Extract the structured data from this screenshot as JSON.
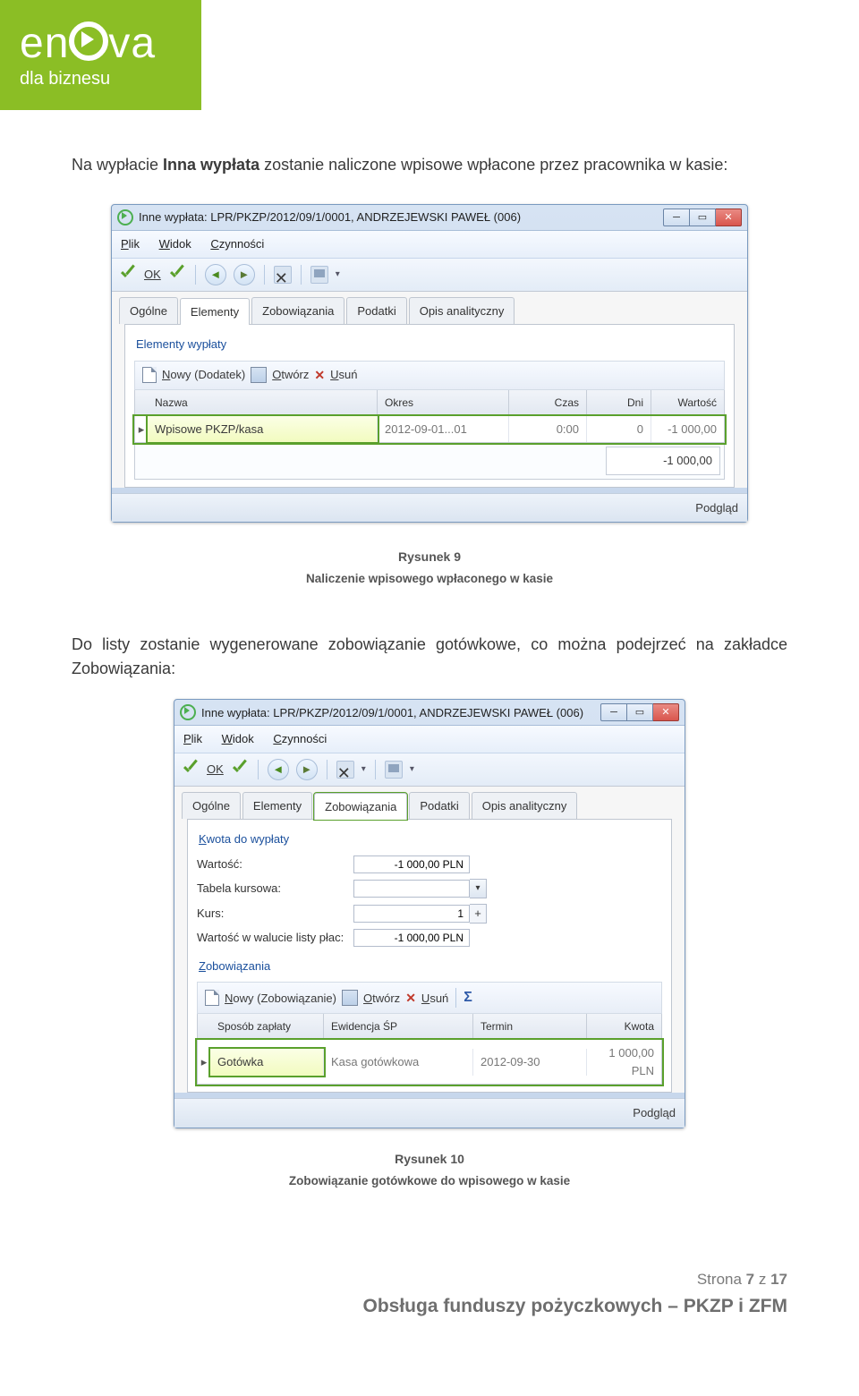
{
  "logo": {
    "brand_prefix": "en",
    "brand_suffix": "va",
    "tagline": "dla biznesu"
  },
  "para1": {
    "t1": "Na wypłacie ",
    "b1": "Inna wypłata",
    "t2": " zostanie naliczone wpisowe wpłacone przez pracownika w kasie:"
  },
  "win1": {
    "title": "Inne wypłata: LPR/PKZP/2012/09/1/0001, ANDRZEJEWSKI PAWEŁ (006)",
    "menu": {
      "plik": "Plik",
      "widok": "Widok",
      "czynnosci": "Czynności"
    },
    "ok": "OK",
    "tabs": {
      "ogolne": "Ogólne",
      "elementy": "Elementy",
      "zobowiazania": "Zobowiązania",
      "podatki": "Podatki",
      "opis": "Opis analityczny"
    },
    "group": "Elementy wypłaty",
    "sub": {
      "nowy": "Nowy (Dodatek)",
      "otworz": "Otwórz",
      "usun": "Usuń"
    },
    "head": {
      "nazwa": "Nazwa",
      "okres": "Okres",
      "czas": "Czas",
      "dni": "Dni",
      "wartosc": "Wartość"
    },
    "row": {
      "nazwa": "Wpisowe PKZP/kasa",
      "okres": "2012-09-01...01",
      "czas": "0:00",
      "dni": "0",
      "wartosc": "-1 000,00"
    },
    "total": "-1 000,00",
    "status": "Podgląd"
  },
  "cap1": {
    "line1": "Rysunek 9",
    "line2": "Naliczenie wpisowego wpłaconego w kasie"
  },
  "para2": "Do listy zostanie wygenerowane zobowiązanie gotówkowe, co można podejrzeć na zakładce Zobowiązania:",
  "win2": {
    "title": "Inne wypłata: LPR/PKZP/2012/09/1/0001, ANDRZEJEWSKI PAWEŁ (006)",
    "menu": {
      "plik": "Plik",
      "widok": "Widok",
      "czynnosci": "Czynności"
    },
    "ok": "OK",
    "tabs": {
      "ogolne": "Ogólne",
      "elementy": "Elementy",
      "zobowiazania": "Zobowiązania",
      "podatki": "Podatki",
      "opis": "Opis analityczny"
    },
    "group1": "Kwota do wypłaty",
    "f": {
      "wartosc_lbl": "Wartość:",
      "wartosc": "-1 000,00 PLN",
      "tabela_lbl": "Tabela kursowa:",
      "tabela": "",
      "kurs_lbl": "Kurs:",
      "kurs": "1",
      "waluta_lbl": "Wartość w walucie listy płac:",
      "waluta": "-1 000,00 PLN"
    },
    "group2": "Zobowiązania",
    "sub": {
      "nowy": "Nowy (Zobowiązanie)",
      "otworz": "Otwórz",
      "usun": "Usuń"
    },
    "head": {
      "sposob": "Sposób zapłaty",
      "ewid": "Ewidencja ŚP",
      "termin": "Termin",
      "kwota": "Kwota"
    },
    "row": {
      "sposob": "Gotówka",
      "ewid": "Kasa gotówkowa",
      "termin": "2012-09-30",
      "kwota": "1 000,00 PLN"
    },
    "status": "Podgląd"
  },
  "cap2": {
    "line1": "Rysunek 10",
    "line2": "Zobowiązanie gotówkowe do wpisowego w kasie"
  },
  "footer": {
    "page_prefix": "Strona ",
    "page_num": "7",
    "page_mid": " z ",
    "page_total": "17",
    "doc_title": "Obsługa funduszy pożyczkowych – PKZP i ZFM"
  }
}
